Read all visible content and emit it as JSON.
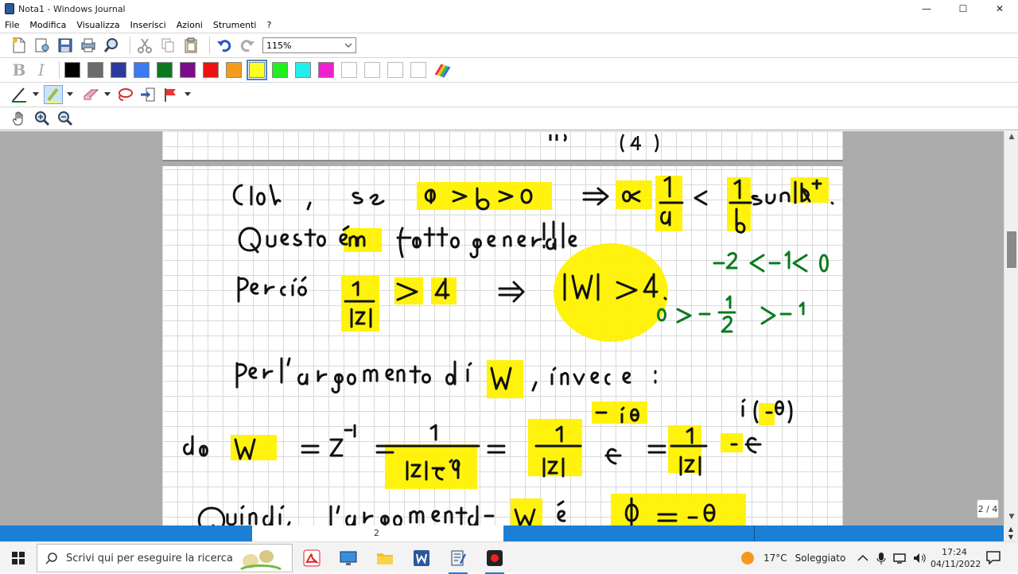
{
  "window": {
    "title": "Nota1 - Windows Journal",
    "minimize": "—",
    "maximize": "☐",
    "close": "✕"
  },
  "menu": [
    "File",
    "Modifica",
    "Visualizza",
    "Inserisci",
    "Azioni",
    "Strumenti",
    "?"
  ],
  "toolbar": {
    "zoom_value": "115%",
    "bold_label": "B",
    "italic_label": "I"
  },
  "colors": {
    "accent": "#1c7fd6",
    "palette": [
      "#000000",
      "#6b6b6b",
      "#2e3a9a",
      "#3a7af2",
      "#0a7a1f",
      "#7a0d8a",
      "#ee1111",
      "#f59b1c",
      "#ffff22",
      "#22ee22",
      "#22eeee",
      "#ee22cc",
      "#ffffff",
      "#ffffff",
      "#ffffff",
      "#ffffff"
    ],
    "selected_index": 8
  },
  "note": {
    "page_number": "2",
    "page_indicator": "2 / 4"
  },
  "taskbar": {
    "search_placeholder": "Scrivi qui per eseguire la ricerca",
    "weather_temp": "17°C",
    "weather_desc": "Soleggiato",
    "time": "17:24",
    "date": "04/11/2022"
  },
  "icons": [
    "windows-logo-icon",
    "search-icon",
    "acrobat-icon",
    "desktop-icon",
    "folder-icon",
    "word-icon",
    "journal-icon",
    "record-icon",
    "sun-icon",
    "chevron-up-icon",
    "microphone-icon",
    "network-icon",
    "volume-icon",
    "notification-icon"
  ]
}
